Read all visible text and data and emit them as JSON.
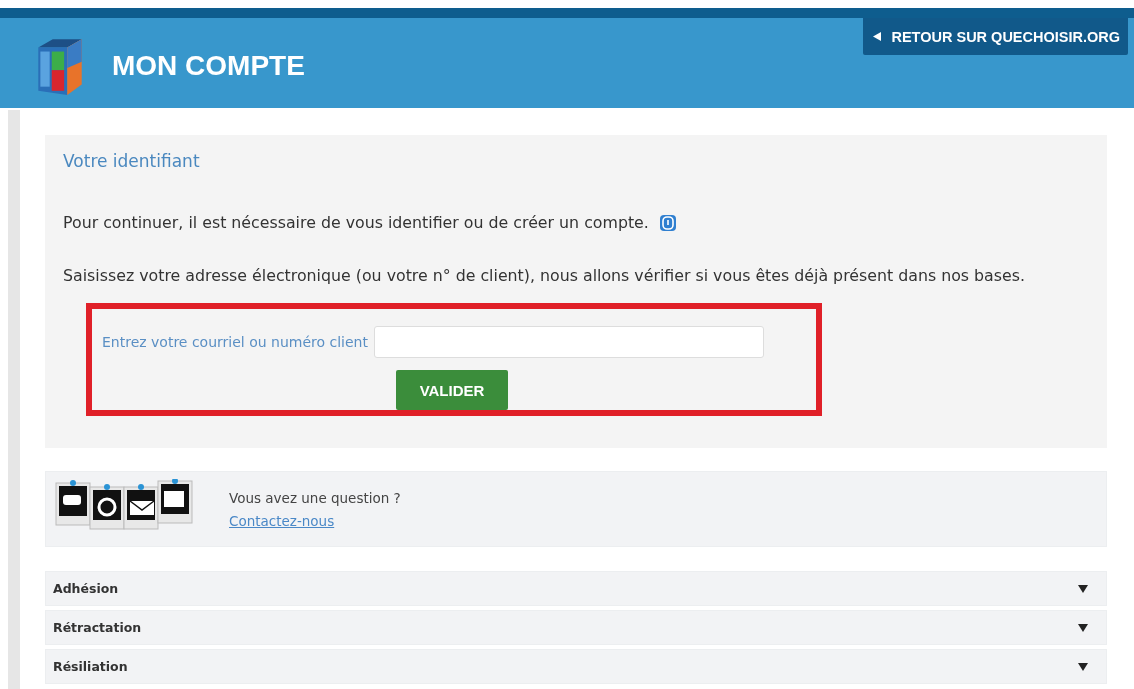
{
  "header": {
    "title": "MON COMPTE",
    "back_link": "RETOUR SUR QUECHOISIR.ORG"
  },
  "identification": {
    "heading": "Votre identifiant",
    "intro": "Pour continuer, il est nécessaire de vous identifier ou de créer un compte.",
    "instructions": "Saisissez votre adresse électronique (ou votre n° de client), nous allons vérifier si vous êtes déjà présent dans nos bases.",
    "field_label": "Entrez votre courriel ou numéro client",
    "submit": "VALIDER",
    "highlighted": true
  },
  "contact": {
    "question": "Vous avez une question ?",
    "link": "Contactez-nous"
  },
  "accordion": [
    {
      "label": "Adhésion",
      "expanded": false
    },
    {
      "label": "Rétractation",
      "expanded": false
    },
    {
      "label": "Résiliation",
      "expanded": false
    }
  ]
}
